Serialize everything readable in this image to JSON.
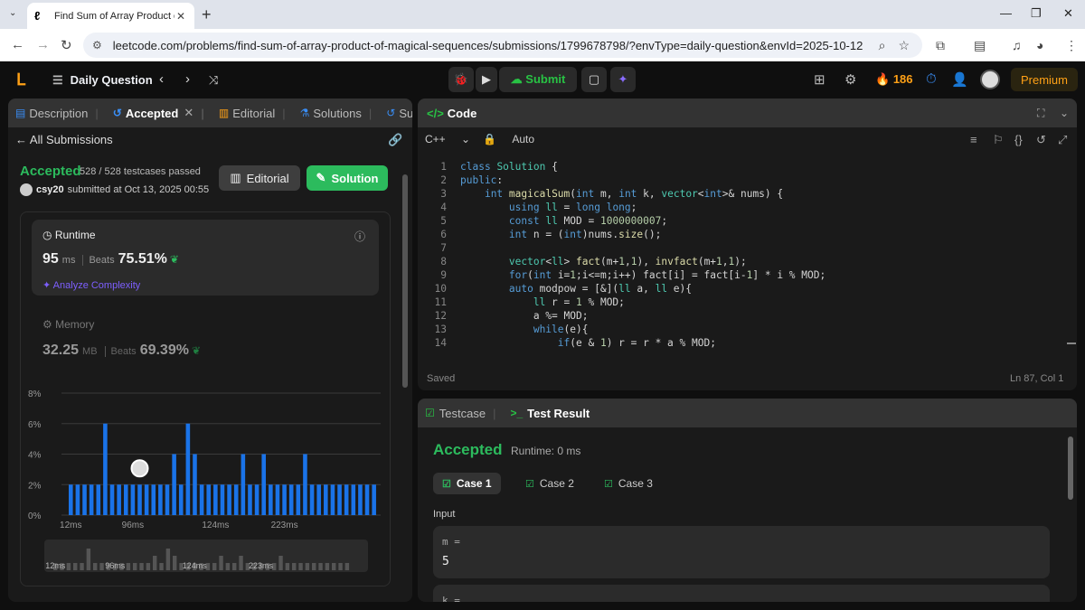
{
  "browser": {
    "tab_title": "Find Sum of Array Product of M",
    "url": "leetcode.com/problems/find-sum-of-array-product-of-magical-sequences/submissions/1799678798/?envType=daily-question&envId=2025-10-12"
  },
  "header": {
    "daily_question": "Daily Question",
    "submit_label": "Submit",
    "streak": "186",
    "premium": "Premium"
  },
  "left_tabs": [
    {
      "label": "Description"
    },
    {
      "label": "Accepted"
    },
    {
      "label": "Editorial"
    },
    {
      "label": "Solutions"
    },
    {
      "label": "Submissio"
    }
  ],
  "submission": {
    "back_label": "All Submissions",
    "status": "Accepted",
    "testcases": "528 / 528 testcases passed",
    "user": "csy20",
    "submitted": "submitted at Oct 13, 2025 00:55",
    "editorial_btn": "Editorial",
    "solution_btn": "Solution",
    "runtime_label": "Runtime",
    "runtime_value": "95",
    "runtime_unit": "ms",
    "beats_label": "Beats",
    "runtime_beats": "75.51%",
    "analyze": "Analyze Complexity",
    "memory_label": "Memory",
    "memory_value": "32.25",
    "memory_unit": "MB",
    "memory_beats": "69.39%"
  },
  "chart_data": {
    "type": "bar",
    "y_ticks": [
      "8%",
      "6%",
      "4%",
      "2%",
      "0%"
    ],
    "ylim": [
      0,
      8
    ],
    "x_tick_labels": [
      "12ms",
      "96ms",
      "124ms",
      "223ms"
    ],
    "x_tick_positions": [
      0,
      9,
      21,
      31
    ],
    "values": [
      2,
      2,
      2,
      2,
      2,
      6,
      2,
      2,
      2,
      2,
      2,
      2,
      2,
      2,
      2,
      4,
      2,
      6,
      4,
      2,
      2,
      2,
      2,
      2,
      2,
      4,
      2,
      2,
      4,
      2,
      2,
      2,
      2,
      2,
      4,
      2,
      2,
      2,
      2,
      2,
      2,
      2,
      2,
      2,
      2
    ],
    "highlight_index": 10
  },
  "code": {
    "title": "Code",
    "language": "C++",
    "mode": "Auto",
    "saved": "Saved",
    "cursor": "Ln 87, Col 1",
    "lines": [
      "class Solution {",
      "public:",
      "    int magicalSum(int m, int k, vector<int>& nums) {",
      "        using ll = long long;",
      "        const ll MOD = 1000000007;",
      "        int n = (int)nums.size();",
      "",
      "        vector<ll> fact(m+1,1), invfact(m+1,1);",
      "        for(int i=1;i<=m;i++) fact[i] = fact[i-1] * i % MOD;",
      "        auto modpow = [&](ll a, ll e){",
      "            ll r = 1 % MOD;",
      "            a %= MOD;",
      "            while(e){",
      "                if(e & 1) r = r * a % MOD;"
    ]
  },
  "test": {
    "tab_testcase": "Testcase",
    "tab_result": "Test Result",
    "status": "Accepted",
    "runtime": "Runtime: 0 ms",
    "cases": [
      "Case 1",
      "Case 2",
      "Case 3"
    ],
    "input_label": "Input",
    "var1_name": "m =",
    "var1_value": "5",
    "var2_name": "k ="
  }
}
